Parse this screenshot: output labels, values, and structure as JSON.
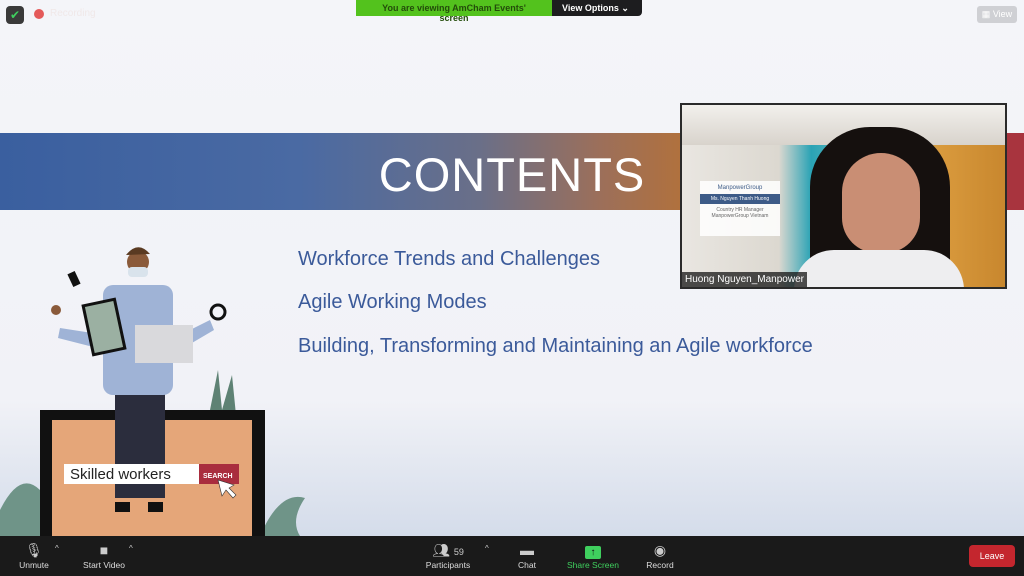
{
  "topbar": {
    "recording_label": "Recording",
    "viewing_label": "You are viewing AmCham Events' screen",
    "view_options_label": "View Options",
    "view_label": "View"
  },
  "slide": {
    "title": "CONTENTS",
    "items": [
      "Workforce Trends and Challenges",
      "Agile Working  Modes",
      "Building, Transforming and Maintaining an Agile workforce"
    ],
    "illustration": {
      "search_text": "Skilled workers",
      "search_button": "SEARCH"
    }
  },
  "video": {
    "participant_name": "Huong Nguyen_Manpower",
    "card": {
      "logo": "ManpowerGroup",
      "name": "Ms. Nguyen Thanh Huong",
      "role": "Country HR Manager",
      "company": "ManpowerGroup Vietnam"
    }
  },
  "toolbar": {
    "unmute": "Unmute",
    "start_video": "Start Video",
    "participants": "Participants",
    "participants_count": "59",
    "chat": "Chat",
    "share_screen": "Share Screen",
    "record": "Record",
    "leave": "Leave"
  },
  "colors": {
    "share_green": "#3fcf5e",
    "leave_red": "#c4262e",
    "banner_blue": "#3a5f9f",
    "item_text": "#3b5a9a"
  }
}
